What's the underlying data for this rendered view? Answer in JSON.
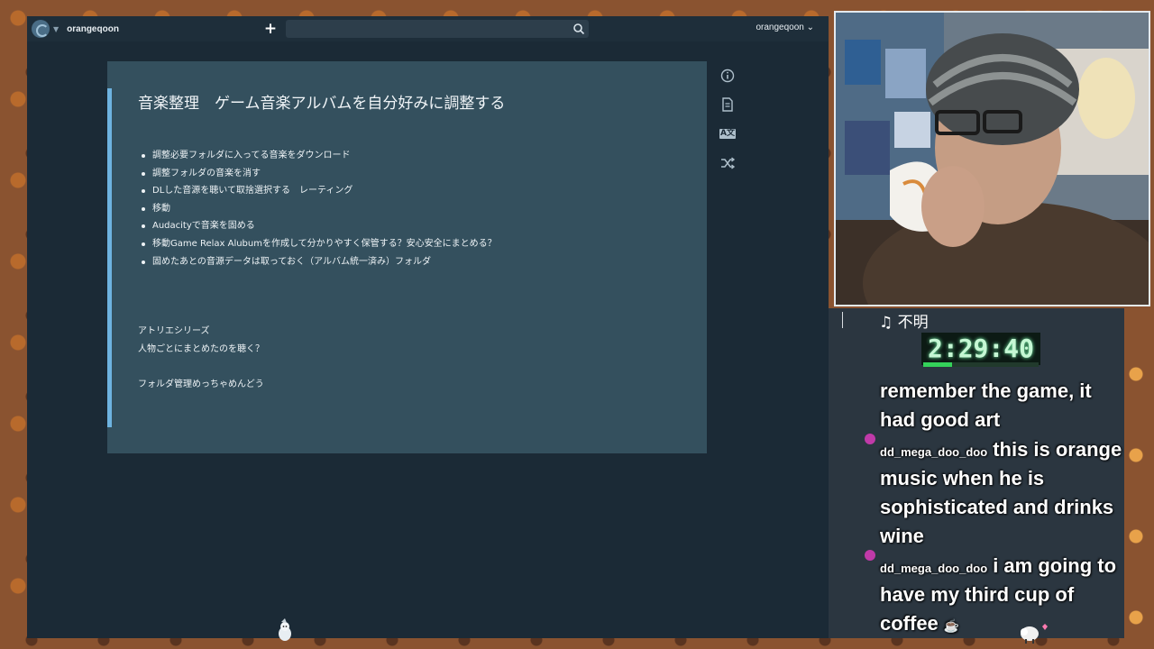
{
  "app": {
    "workspace_name": "orangeqoon",
    "user_menu": "orangeqoon ⌄",
    "search_placeholder": ""
  },
  "note": {
    "title": "音楽整理　ゲーム音楽アルバムを自分好みに調整する",
    "list_items": [
      "調整必要フォルダに入ってる音楽をダウンロード",
      "調整フォルダの音楽を消す",
      "DLした音源を聴いて取捨選択する　レーティング",
      "移動",
      "Audacityで音楽を固める",
      "移動Game Relax Alubumを作成して分かりやすく保管する？安心安全にまとめる？",
      "固めたあとの音源データは取っておく（アルバム統一済み）フォルダ"
    ],
    "paragraphs": [
      "アトリエシリーズ",
      "人物ごとにまとめたのを聴く？",
      "フォルダ管理めっちゃめんどう"
    ]
  },
  "tools": {
    "icons": [
      "info-icon",
      "document-icon",
      "translate-icon",
      "shuffle-icon"
    ],
    "translate_glyph": "A文"
  },
  "overlay": {
    "song": "♫ 不明",
    "timer": "2:29:40",
    "timer_progress": 0.25,
    "chat": [
      {
        "user": "",
        "message": "remember the game, it"
      },
      {
        "user": "",
        "message": "had good art"
      },
      {
        "user": "dd_mega_doo_doo",
        "message": "this is orange"
      },
      {
        "user": "",
        "message": "music when he is"
      },
      {
        "user": "",
        "message": "sophisticated and drinks"
      },
      {
        "user": "",
        "message": "wine"
      },
      {
        "user": "dd_mega_doo_doo",
        "message": "i am going to"
      },
      {
        "user": "",
        "message": "have my third cup of"
      },
      {
        "user": "",
        "message": "coffee"
      }
    ]
  },
  "colors": {
    "app_bg": "#1b2a36",
    "card_bg": "#34505e",
    "accent": "#6eb3e0",
    "timer_green": "#34d25a"
  }
}
